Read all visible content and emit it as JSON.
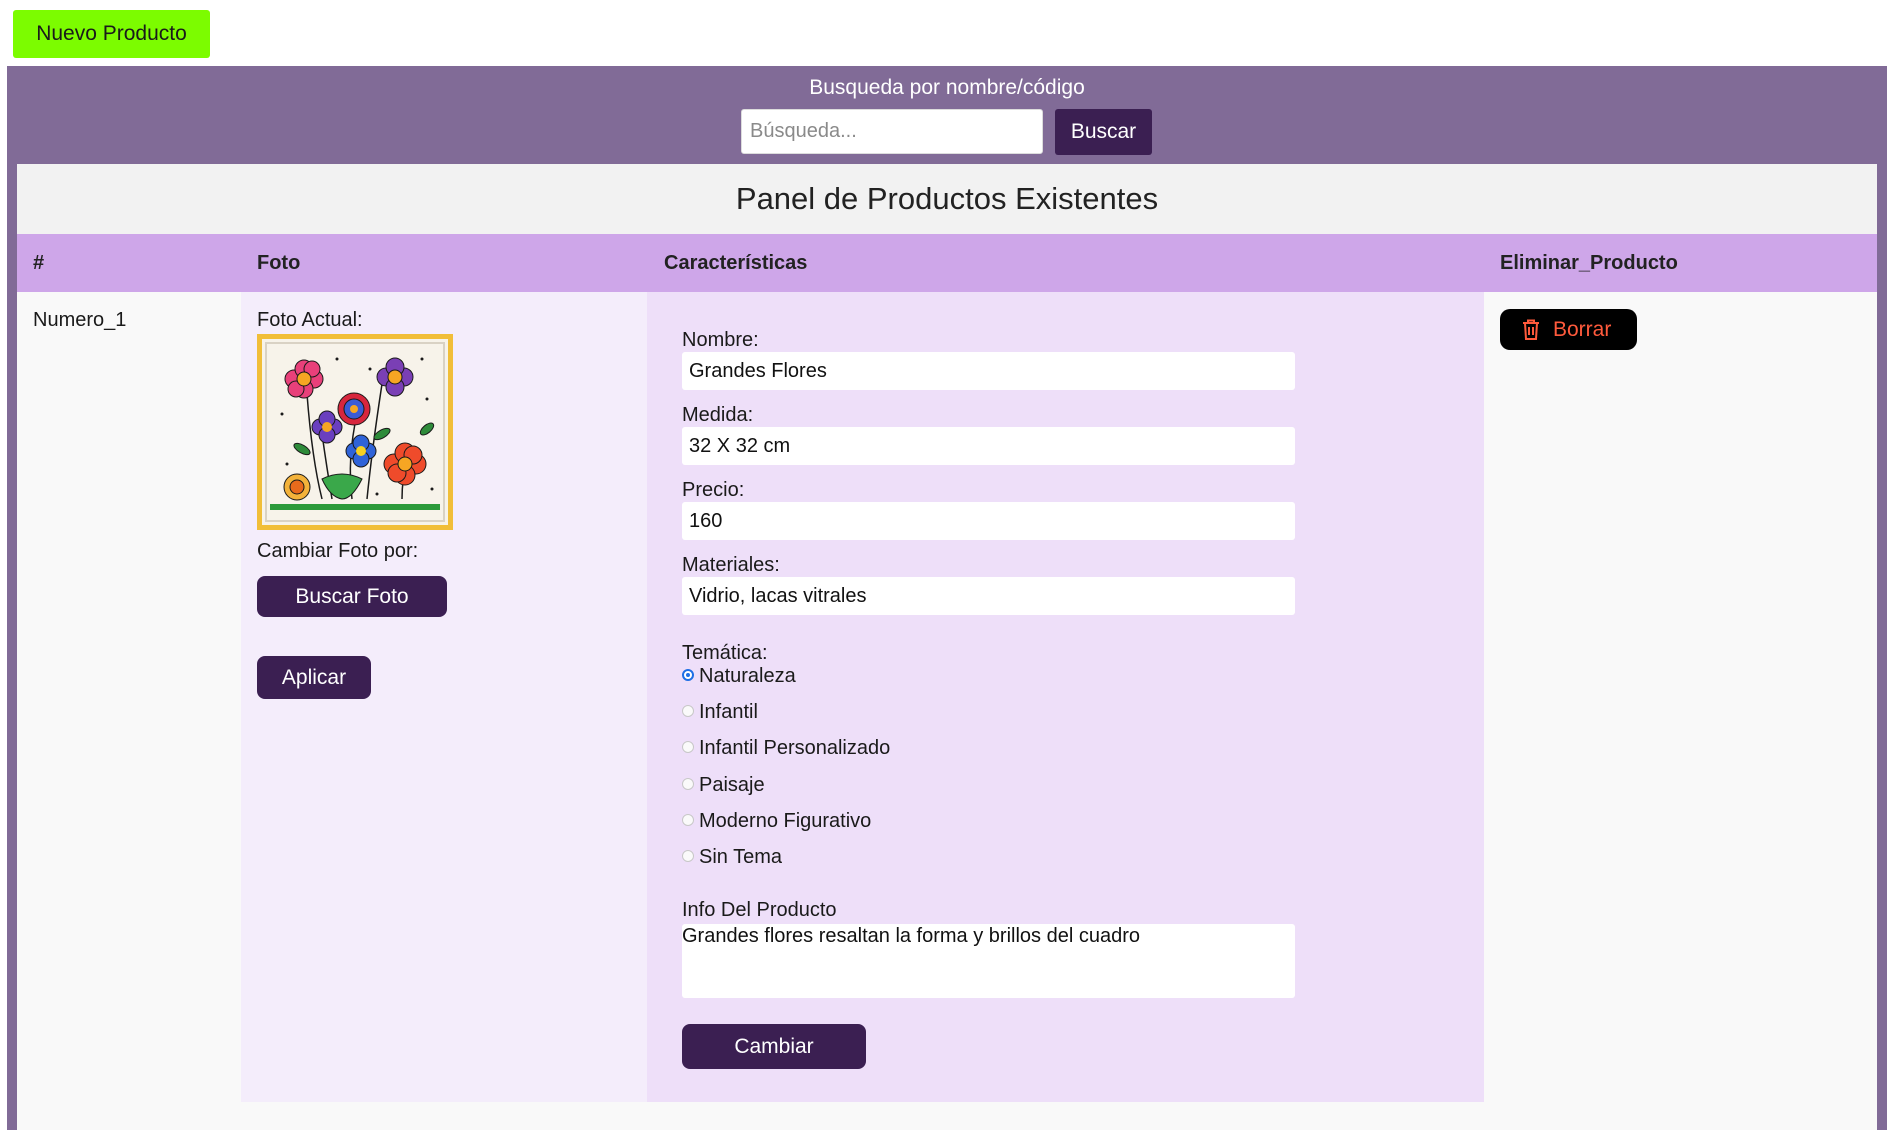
{
  "toolbar": {
    "new_product_label": "Nuevo Producto"
  },
  "search": {
    "label": "Busqueda por nombre/código",
    "placeholder": "Búsqueda...",
    "value": "",
    "button_label": "Buscar"
  },
  "panel": {
    "title": "Panel de Productos Existentes",
    "columns": [
      "#",
      "Foto",
      "Características",
      "Eliminar_Producto"
    ]
  },
  "product": {
    "number": "Numero_1",
    "photo": {
      "current_label": "Foto Actual:",
      "change_label": "Cambiar Foto por:",
      "browse_label": "Buscar Foto",
      "apply_label": "Aplicar"
    },
    "fields": {
      "name_label": "Nombre:",
      "name_value": "Grandes Flores",
      "size_label": "Medida:",
      "size_value": "32 X 32 cm",
      "price_label": "Precio:",
      "price_value": "160",
      "materials_label": "Materiales:",
      "materials_value": "Vidrio, lacas vitrales"
    },
    "theme": {
      "label": "Temática:",
      "options": [
        "Naturaleza",
        "Infantil",
        "Infantil Personalizado",
        "Paisaje",
        "Moderno Figurativo",
        "Sin Tema"
      ],
      "selected": "Naturaleza"
    },
    "info": {
      "label": "Info Del Producto",
      "value": "Grandes flores resaltan la forma y brillos del cuadro"
    },
    "submit_label": "Cambiar",
    "delete_label": "Borrar"
  },
  "colors": {
    "new_product_bg": "#7cfc00",
    "frame_purple": "#816b97",
    "button_dark": "#3b1f52",
    "table_header": "#cea6e9",
    "delete_text": "#ff5a3c",
    "photo_border": "#f1be38"
  },
  "icons": {
    "delete": "trash-icon",
    "photo": "flower-painting-thumbnail"
  }
}
